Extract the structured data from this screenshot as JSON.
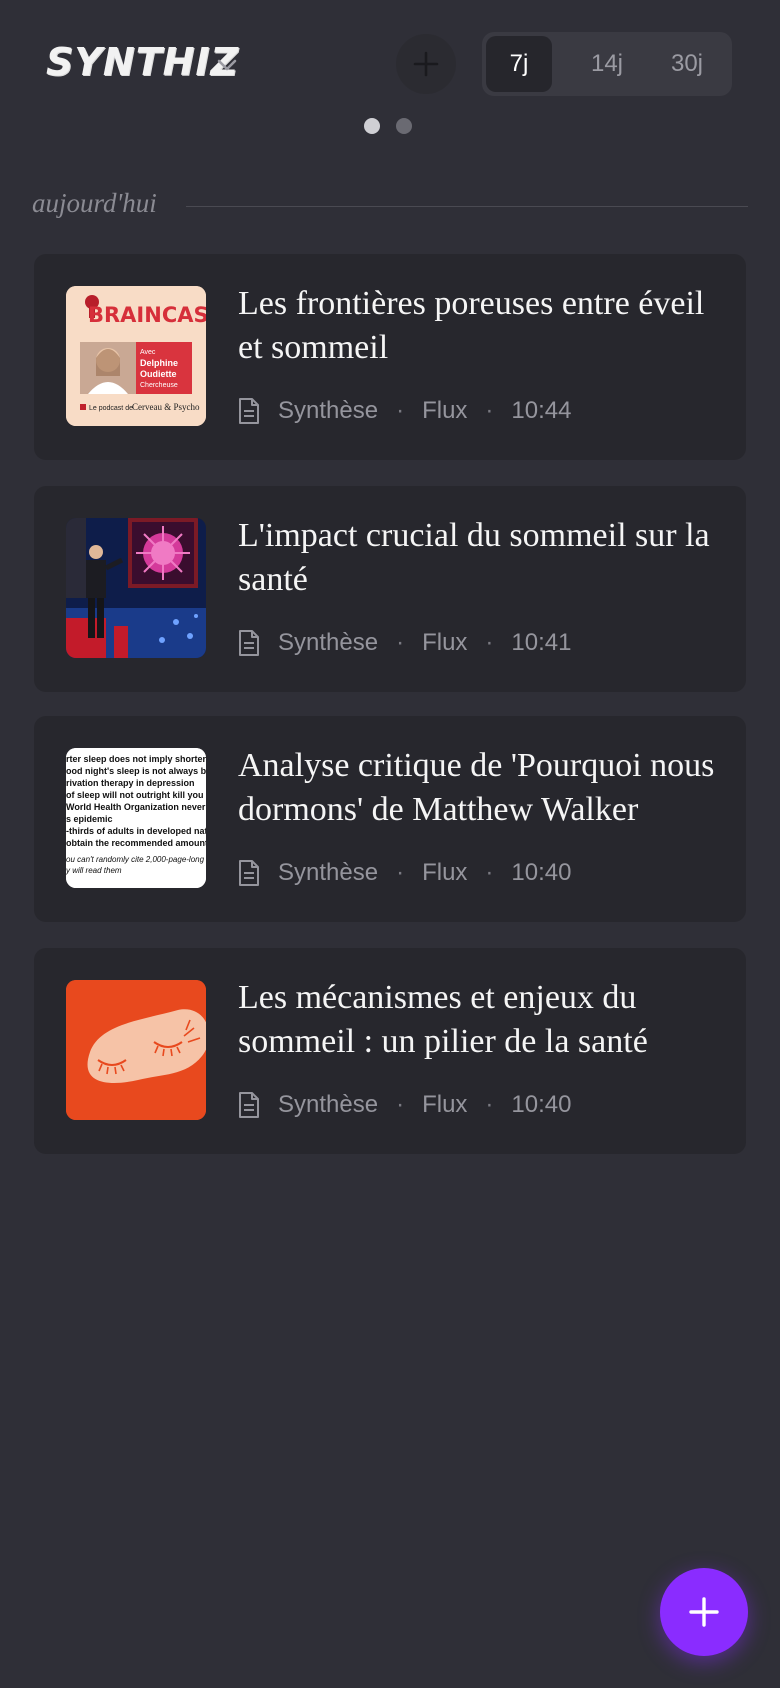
{
  "app": {
    "name": "SYNTHIZ"
  },
  "range_filter": {
    "options": [
      {
        "label": "7j",
        "active": true
      },
      {
        "label": "14j",
        "active": false
      },
      {
        "label": "30j",
        "active": false
      }
    ]
  },
  "pager": {
    "count": 2,
    "current": 1
  },
  "section": {
    "title": "aujourd'hui"
  },
  "items": [
    {
      "title": "Les frontières poreuses entre éveil et sommeil",
      "type": "Synthèse",
      "source": "Flux",
      "time": "10:44",
      "thumb": {
        "brand": "BRAINCAST",
        "line1": "Avec",
        "line2": "Delphine Oudiette",
        "line3": "Chercheuse",
        "footer": "Le podcast de",
        "footer_brand": "Cerveau & Psycho"
      }
    },
    {
      "title": "L'impact crucial du sommeil sur la santé",
      "type": "Synthèse",
      "source": "Flux",
      "time": "10:41"
    },
    {
      "title": "Analyse critique de 'Pourquoi nous dormons' de Matthew Walker",
      "type": "Synthèse",
      "source": "Flux",
      "time": "10:40",
      "thumb_lines": [
        "rter sleep does not imply shorter li",
        "ood night's sleep is not always ben",
        "rivation therapy in depression",
        " of sleep will not outright kill you",
        " World Health Organization never",
        "s epidemic",
        "-thirds of adults in developed nat",
        " obtain the recommended amount",
        "ou can't randomly cite 2,000-page-long",
        "y will read them"
      ]
    },
    {
      "title": "Les mécanismes et enjeux du sommeil : un pilier de la santé",
      "type": "Synthèse",
      "source": "Flux",
      "time": "10:40"
    }
  ],
  "colors": {
    "background": "#2f2f37",
    "card": "#27272d",
    "accent": "#8a2cff"
  },
  "icons": [
    "chevron-down-icon",
    "plus-icon",
    "document-icon",
    "fab-plus-icon"
  ]
}
